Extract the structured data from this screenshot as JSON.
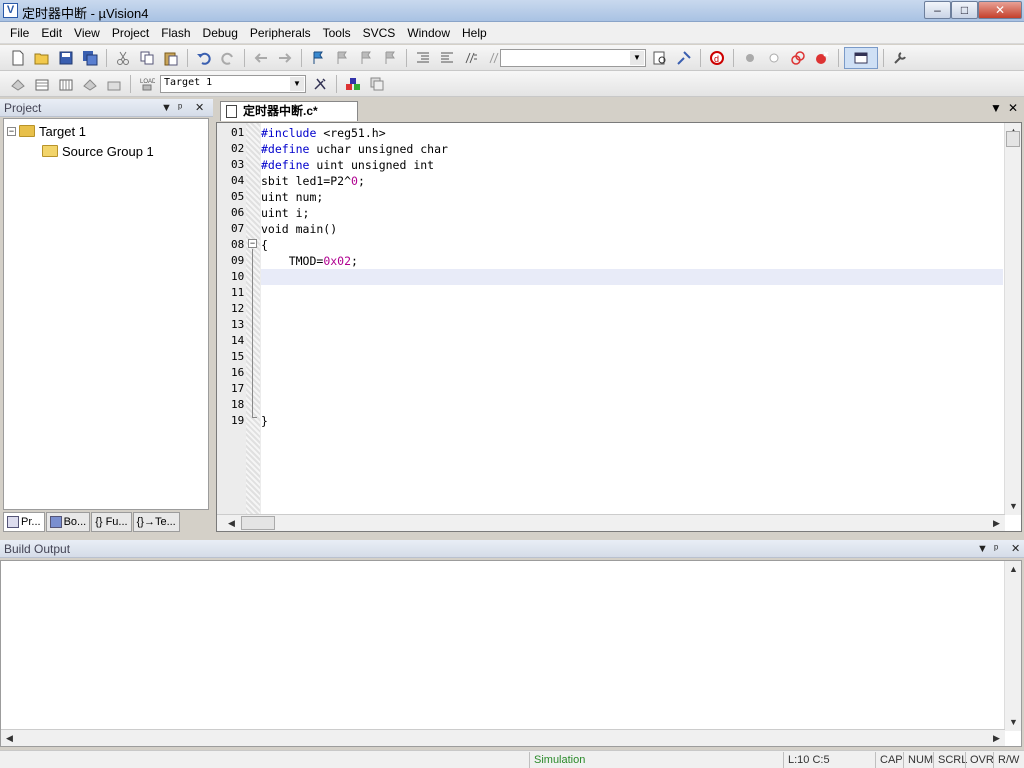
{
  "window": {
    "title": "定时器中断  - µVision4",
    "app_icon": "V",
    "minimize": "–",
    "maximize": "□",
    "close": "✕"
  },
  "menu": [
    "File",
    "Edit",
    "View",
    "Project",
    "Flash",
    "Debug",
    "Peripherals",
    "Tools",
    "SVCS",
    "Window",
    "Help"
  ],
  "toolbar": {
    "target_combo": "Target 1"
  },
  "project_panel": {
    "title": "Project",
    "tree": {
      "target": "Target 1",
      "group": "Source Group 1"
    },
    "tabs": [
      "Pr...",
      "Bo...",
      "{} Fu...",
      "{}→Te..."
    ]
  },
  "editor": {
    "tab_label": "定时器中断.c*",
    "lines": [
      {
        "no": "01",
        "segs": [
          [
            "kw",
            "#include"
          ],
          [
            "",
            " <reg51.h>"
          ]
        ]
      },
      {
        "no": "02",
        "segs": [
          [
            "kw",
            "#define"
          ],
          [
            "",
            " uchar unsigned char"
          ]
        ]
      },
      {
        "no": "03",
        "segs": [
          [
            "kw",
            "#define"
          ],
          [
            "",
            " uint unsigned int"
          ]
        ]
      },
      {
        "no": "04",
        "segs": [
          [
            "",
            "sbit led1=P2^"
          ],
          [
            "num",
            "0"
          ],
          [
            "",
            ";"
          ]
        ]
      },
      {
        "no": "05",
        "segs": [
          [
            "",
            "uint num;"
          ]
        ]
      },
      {
        "no": "06",
        "segs": [
          [
            "",
            "uint i;"
          ]
        ]
      },
      {
        "no": "07",
        "segs": [
          [
            "",
            "void main()"
          ]
        ]
      },
      {
        "no": "08",
        "segs": [
          [
            "",
            "{"
          ]
        ]
      },
      {
        "no": "09",
        "segs": [
          [
            "",
            "    TMOD="
          ],
          [
            "num",
            "0x02"
          ],
          [
            "",
            ";"
          ]
        ]
      },
      {
        "no": "10",
        "segs": [
          [
            "",
            ""
          ]
        ]
      },
      {
        "no": "11",
        "segs": [
          [
            "",
            ""
          ]
        ]
      },
      {
        "no": "12",
        "segs": [
          [
            "",
            ""
          ]
        ]
      },
      {
        "no": "13",
        "segs": [
          [
            "",
            ""
          ]
        ]
      },
      {
        "no": "14",
        "segs": [
          [
            "",
            ""
          ]
        ]
      },
      {
        "no": "15",
        "segs": [
          [
            "",
            ""
          ]
        ]
      },
      {
        "no": "16",
        "segs": [
          [
            "",
            ""
          ]
        ]
      },
      {
        "no": "17",
        "segs": [
          [
            "",
            ""
          ]
        ]
      },
      {
        "no": "18",
        "segs": [
          [
            "",
            ""
          ]
        ]
      },
      {
        "no": "19",
        "segs": [
          [
            "",
            "}"
          ]
        ]
      }
    ]
  },
  "build_output": {
    "title": "Build Output"
  },
  "statusbar": {
    "mode": "Simulation",
    "position": "L:10 C:5",
    "cap": "CAP",
    "num": "NUM",
    "scrl": "SCRL",
    "ovr": "OVR",
    "rw": "R/W"
  },
  "colors": {
    "keyword": "#0000cc",
    "number": "#b00090",
    "simulation": "#2a8a2a"
  }
}
